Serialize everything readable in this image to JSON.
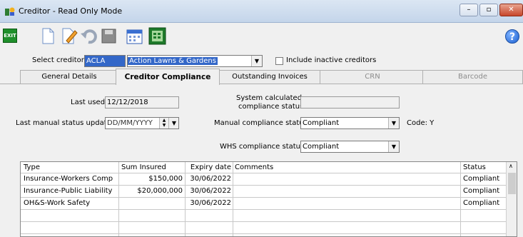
{
  "window": {
    "title": "Creditor - Read Only Mode"
  },
  "toolbar": {
    "exit_label": "EXIT",
    "icons": [
      "exit-icon",
      "new-document-icon",
      "edit-icon",
      "undo-icon",
      "save-icon",
      "calendar-icon",
      "report-icon"
    ],
    "help_label": "?"
  },
  "creditor": {
    "select_label": "Select creditor",
    "code": "ACLA",
    "name": "Action Lawns & Gardens",
    "inactive_label": "Include inactive creditors"
  },
  "tabs": [
    {
      "label": "General Details",
      "active": false,
      "enabled": true
    },
    {
      "label": "Creditor Compliance",
      "active": true,
      "enabled": true
    },
    {
      "label": "Outstanding Invoices",
      "active": false,
      "enabled": true
    },
    {
      "label": "CRN",
      "active": false,
      "enabled": false
    },
    {
      "label": "Barcode",
      "active": false,
      "enabled": false
    }
  ],
  "compliance": {
    "last_used_label": "Last used",
    "last_used_value": "12/12/2018",
    "last_manual_label": "Last manual status updated",
    "last_manual_value": "DD/MM/YYYY",
    "system_calc_label_1": "System calculated",
    "system_calc_label_2": "compliance status",
    "system_calc_value": "",
    "manual_status_label": "Manual compliance status",
    "manual_status_value": "Compliant",
    "code_text": "Code: Y",
    "whs_status_label": "WHS compliance status",
    "whs_status_value": "Compliant"
  },
  "grid": {
    "headers": [
      "Type",
      "Sum Insured",
      "Expiry date",
      "Comments",
      "Status"
    ],
    "rows": [
      [
        "Insurance-Workers Comp",
        "$150,000",
        "30/06/2022",
        "",
        "Compliant"
      ],
      [
        "Insurance-Public Liability",
        "$20,000,000",
        "30/06/2022",
        "",
        "Compliant"
      ],
      [
        "OH&S-Work Safety",
        "",
        "30/06/2022",
        "",
        "Compliant"
      ],
      [
        "",
        "",
        "",
        "",
        ""
      ],
      [
        "",
        "",
        "",
        "",
        ""
      ]
    ]
  }
}
